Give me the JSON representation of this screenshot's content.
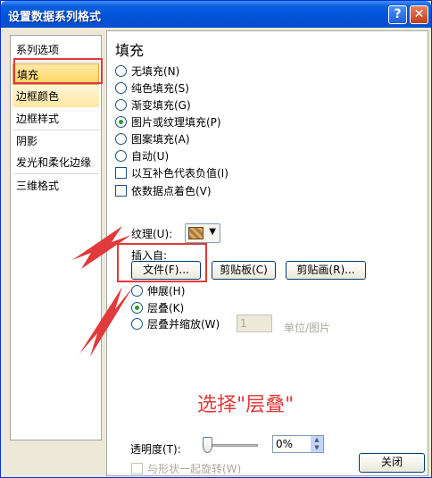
{
  "window": {
    "title": "设置数据系列格式",
    "help_glyph": "?",
    "close_glyph": "✕"
  },
  "nav": {
    "items": [
      {
        "label": "系列选项"
      },
      {
        "label": "填充"
      },
      {
        "label": "边框颜色"
      },
      {
        "label": "边框样式"
      },
      {
        "label": "阴影"
      },
      {
        "label": "发光和柔化边缘"
      },
      {
        "label": "三维格式"
      }
    ],
    "selected": "填充"
  },
  "panel": {
    "section_title": "填充",
    "fill_options": [
      {
        "label": "无填充(N)",
        "checked": false
      },
      {
        "label": "纯色填充(S)",
        "checked": false
      },
      {
        "label": "渐变填充(G)",
        "checked": false
      },
      {
        "label": "图片或纹理填充(P)",
        "checked": true
      },
      {
        "label": "图案填充(A)",
        "checked": false
      },
      {
        "label": "自动(U)",
        "checked": false
      }
    ],
    "checkboxes": [
      {
        "label": "以互补色代表负值(I)",
        "checked": false
      },
      {
        "label": "依数据点着色(V)",
        "checked": false
      }
    ],
    "texture_label": "纹理(U):",
    "texture_arrow": "▼",
    "insert_from_label": "插入自:",
    "buttons": {
      "file": "文件(F)...",
      "clipboard": "剪贴板(C)",
      "clipart": "剪贴画(R)..."
    },
    "stack_options": [
      {
        "label": "伸展(H)",
        "checked": false
      },
      {
        "label": "层叠(K)",
        "checked": true
      },
      {
        "label": "层叠并缩放(W)",
        "checked": false
      }
    ],
    "units_value": "1",
    "units_label": "单位/图片",
    "transparency_label": "透明度(T):",
    "transparency_value": "0%",
    "transparency_fraction": 0,
    "spin_up": "▲",
    "spin_down": "▼",
    "rotate_label": "与形状一起旋转(W)"
  },
  "annotation": {
    "text": "选择\"层叠\""
  },
  "footer": {
    "close_label": "关闭"
  },
  "colors": {
    "titlebar": "#0a5fe0",
    "annotation_red": "#e03a3a",
    "selected_nav": "#ffd35e"
  }
}
